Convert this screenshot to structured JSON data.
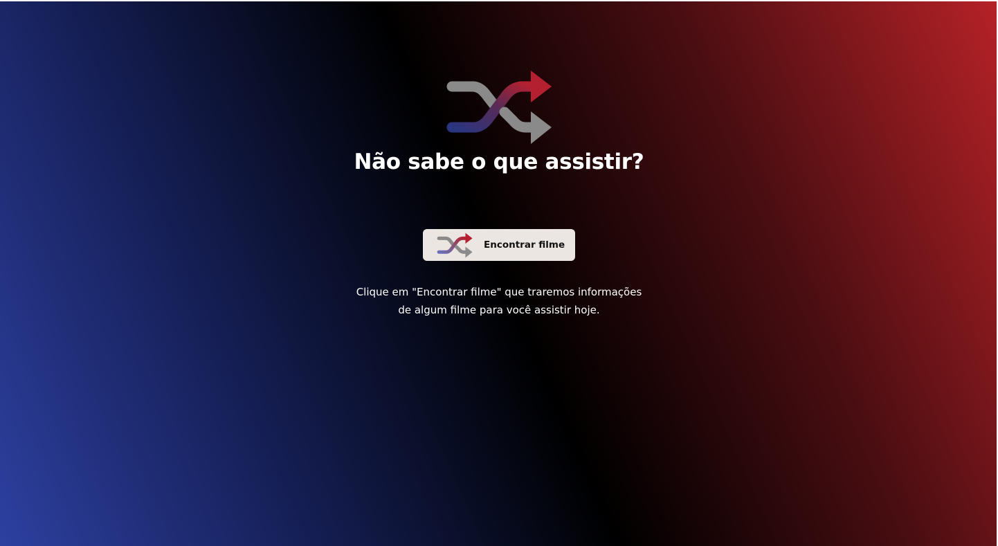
{
  "hero": {
    "icon": "shuffle-icon",
    "title": "Não sabe o que assistir?"
  },
  "find_button": {
    "icon": "shuffle-icon",
    "label": "Encontrar filme"
  },
  "description": {
    "line1": "Clique em \"Encontrar filme\" que traremos informações",
    "line2": "de algum filme para você assistir hoje."
  },
  "colors": {
    "background_left": "#2d40a0",
    "background_center": "#000000",
    "background_right": "#b52227",
    "button_background": "#ece6e3",
    "icon_gray": "#8a8a8a",
    "icon_red": "#b52030",
    "icon_blue": "#2a3580"
  }
}
